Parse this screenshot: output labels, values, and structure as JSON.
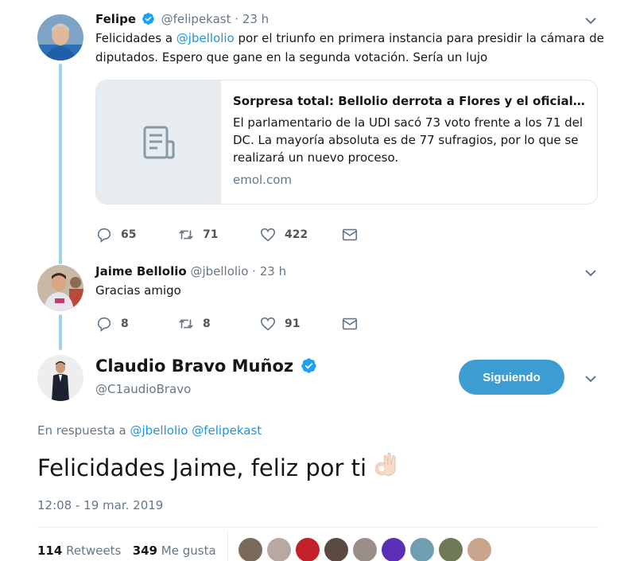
{
  "tweet1": {
    "name": "Felipe",
    "handle": "@felipekast",
    "sep": "·",
    "time": "23 h",
    "text_before": "Felicidades a ",
    "mention": "@jbellolio",
    "text_after": " por el triunfo en primera instancia para presidir la cámara de diputados. Espero que gane en la segunda votación. Sería un lujo",
    "card": {
      "title": "Sorpresa total: Bellolio derrota a Flores y el oficiali...",
      "description": "El parlamentario de la UDI sacó 73 voto frente a los 71 del DC. La mayoría absoluta es de 77 sufragios, por lo que se realizará un nuevo proceso.",
      "domain": "emol.com"
    },
    "replies": "65",
    "retweets": "71",
    "likes": "422"
  },
  "tweet2": {
    "name": "Jaime Bellolio",
    "handle": "@jbellolio",
    "sep": "·",
    "time": "23 h",
    "text": "Gracias amigo",
    "replies": "8",
    "retweets": "8",
    "likes": "91"
  },
  "main": {
    "name": "Claudio Bravo Muñoz",
    "handle": "@C1audioBravo",
    "follow_label": "Siguiendo",
    "reply_prefix": "En respuesta a ",
    "reply_mention1": "@jbellolio",
    "reply_mention2": "@felipekast",
    "text": "Felicidades Jaime, feliz por ti",
    "timestamp": "12:08 - 19 mar. 2019",
    "retweets_count": "114",
    "retweets_label": "Retweets",
    "likes_count": "349",
    "likes_label": "Me gusta"
  },
  "colors": {
    "accent": "#1b95e0",
    "follow_button": "#3d9dd3",
    "thread_line": "#9fd3ea"
  },
  "icons": [
    "verified-icon",
    "reply-icon",
    "retweet-icon",
    "like-icon",
    "message-icon",
    "chevron-down-icon",
    "article-icon",
    "ok-hand-emoji"
  ]
}
